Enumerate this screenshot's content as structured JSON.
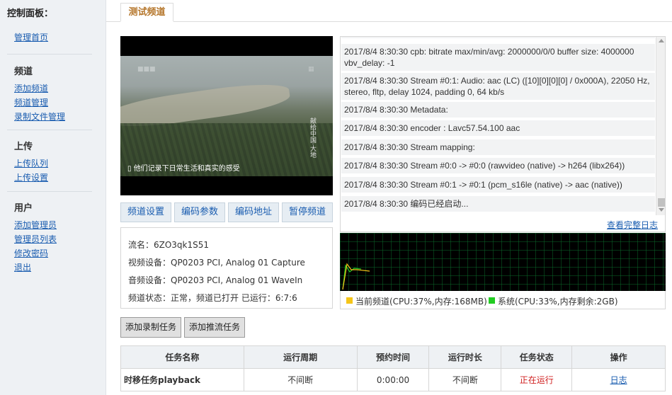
{
  "sidebar": {
    "title": "控制面板：",
    "home": "管理首页",
    "sections": [
      {
        "heading": "频道",
        "items": [
          "添加频道",
          "频道管理",
          "录制文件管理"
        ]
      },
      {
        "heading": "上传",
        "items": [
          "上传队列",
          "上传设置"
        ]
      },
      {
        "heading": "用户",
        "items": [
          "添加管理员",
          "管理员列表",
          "修改密码",
          "退出"
        ]
      }
    ]
  },
  "tab": {
    "label": "测试频道"
  },
  "video": {
    "subtitle": "他们记录下日常生活和真实的感受",
    "vertical_caption": "献给中国·大地"
  },
  "controls": {
    "settings": "频道设置",
    "encode_params": "编码参数",
    "encode_address": "编码地址",
    "pause": "暂停频道"
  },
  "info": {
    "stream": "流名：6ZO3qk1S51",
    "video_device": "视频设备：QP0203 PCI, Analog 01 Capture",
    "audio_device": "音频设备：QP0203 PCI, Analog 01 WaveIn",
    "status": "频道状态：正常，频道已打开 已运行：6:7:6"
  },
  "log": {
    "entries": [
      "2017/8/4 8:30:30 cpb: bitrate max/min/avg: 2000000/0/0 buffer size: 4000000 vbv_delay: -1",
      "2017/8/4 8:30:30 Stream #0:1: Audio: aac (LC) ([10][0][0][0] / 0x000A), 22050 Hz, stereo, fltp, delay 1024, padding 0, 64 kb/s",
      "2017/8/4 8:30:30 Metadata:",
      "2017/8/4 8:30:30 encoder : Lavc57.54.100 aac",
      "2017/8/4 8:30:30 Stream mapping:",
      "2017/8/4 8:30:30 Stream #0:0 -> #0:0 (rawvideo (native) -> h264 (libx264))",
      "2017/8/4 8:30:30 Stream #0:1 -> #0:1 (pcm_s16le (native) -> aac (native))",
      "2017/8/4 8:30:30 编码已经启动..."
    ],
    "full_log_link": "查看完整日志"
  },
  "monitor": {
    "current_color": "#f5c518",
    "system_color": "#22cc22",
    "current_label": "当前频道(CPU:37%,内存:168MB)",
    "system_label": "系统(CPU:33%,内存剩余:2GB)"
  },
  "tasks": {
    "add_record": "添加录制任务",
    "add_push": "添加推流任务"
  },
  "table": {
    "headers": [
      "任务名称",
      "运行周期",
      "预约时间",
      "运行时长",
      "任务状态",
      "操作"
    ],
    "rows": [
      {
        "name": "时移任务playback",
        "period": "不间断",
        "scheduled": "0:00:00",
        "duration": "不间断",
        "status": "正在运行",
        "action": "日志"
      }
    ]
  }
}
